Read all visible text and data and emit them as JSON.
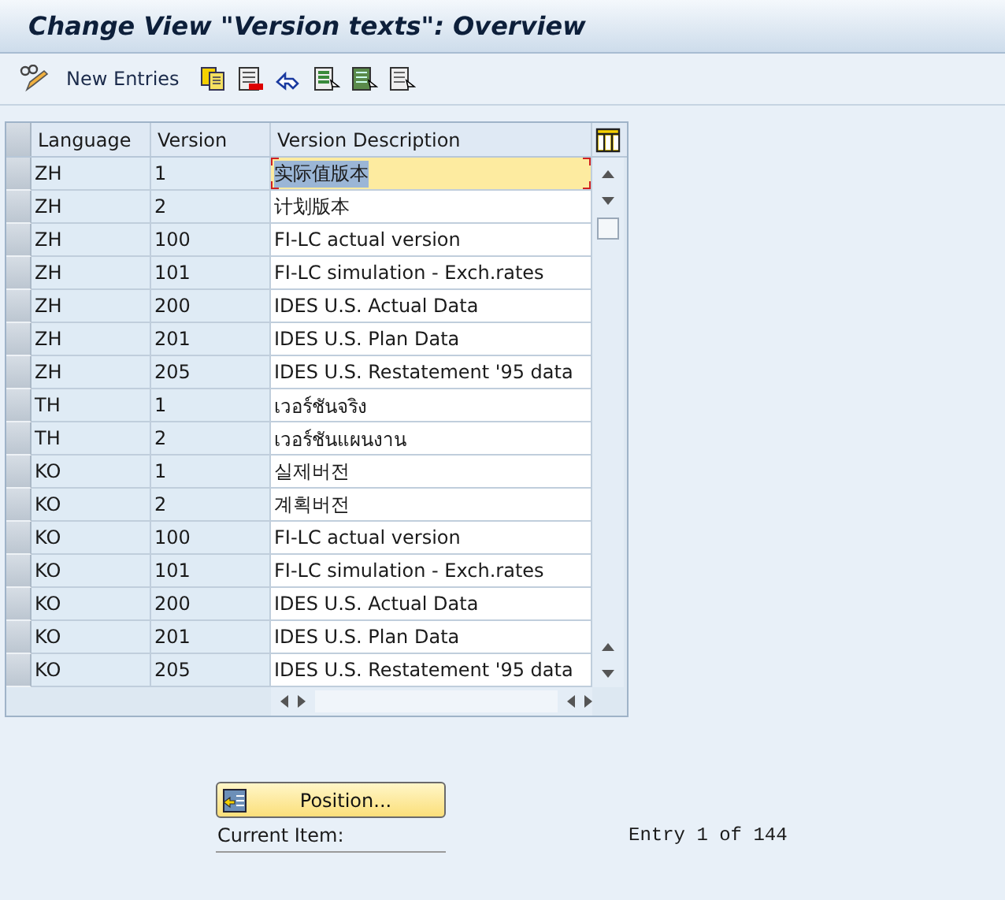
{
  "window": {
    "title": "Change View \"Version texts\": Overview"
  },
  "toolbar": {
    "new_entries": "New Entries"
  },
  "table": {
    "columns": [
      "Language",
      "Version",
      "Version Description"
    ],
    "rows": [
      {
        "language": "ZH",
        "version": "1",
        "description": "实际值版本",
        "selected": true
      },
      {
        "language": "ZH",
        "version": "2",
        "description": "计划版本",
        "selected": false
      },
      {
        "language": "ZH",
        "version": "100",
        "description": "FI-LC actual version",
        "selected": false
      },
      {
        "language": "ZH",
        "version": "101",
        "description": "FI-LC simulation - Exch.rates",
        "selected": false
      },
      {
        "language": "ZH",
        "version": "200",
        "description": "IDES U.S. Actual Data",
        "selected": false
      },
      {
        "language": "ZH",
        "version": "201",
        "description": "IDES U.S. Plan Data",
        "selected": false
      },
      {
        "language": "ZH",
        "version": "205",
        "description": "IDES U.S. Restatement '95 data",
        "selected": false
      },
      {
        "language": "TH",
        "version": "1",
        "description": "เวอร์ชันจริง",
        "selected": false
      },
      {
        "language": "TH",
        "version": "2",
        "description": "เวอร์ชันแผนงาน",
        "selected": false
      },
      {
        "language": "KO",
        "version": "1",
        "description": "실제버전",
        "selected": false
      },
      {
        "language": "KO",
        "version": "2",
        "description": "계획버전",
        "selected": false
      },
      {
        "language": "KO",
        "version": "100",
        "description": "FI-LC actual version",
        "selected": false
      },
      {
        "language": "KO",
        "version": "101",
        "description": "FI-LC simulation - Exch.rates",
        "selected": false
      },
      {
        "language": "KO",
        "version": "200",
        "description": "IDES U.S. Actual Data",
        "selected": false
      },
      {
        "language": "KO",
        "version": "201",
        "description": "IDES U.S. Plan Data",
        "selected": false
      },
      {
        "language": "KO",
        "version": "205",
        "description": "IDES U.S. Restatement '95 data",
        "selected": false
      }
    ]
  },
  "position_button": "Position...",
  "current_item_label": "Current Item:",
  "entry_count": "Entry 1 of 144"
}
